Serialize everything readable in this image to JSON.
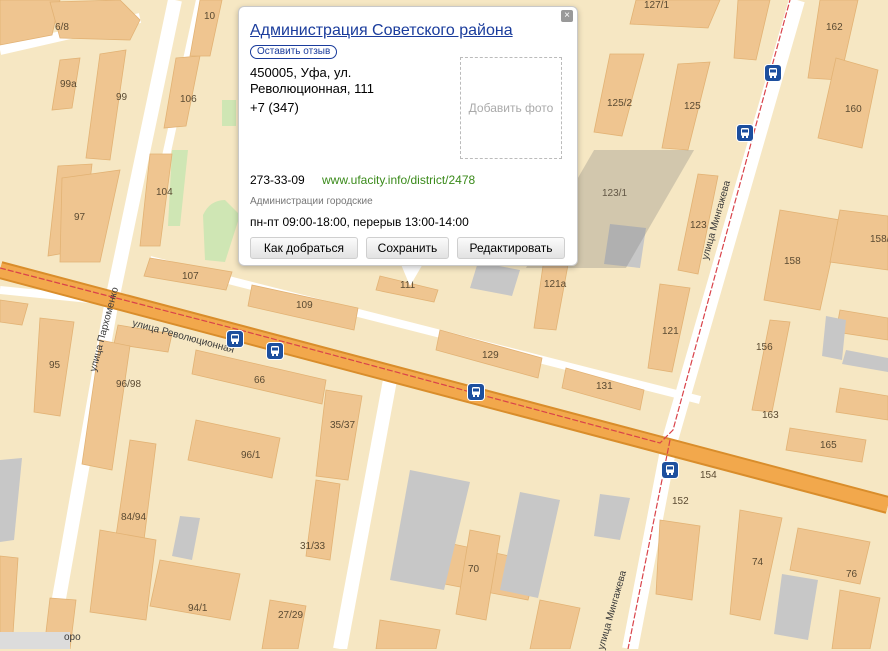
{
  "popup": {
    "title": "Администрация Советского района",
    "review_label": "Оставить отзыв",
    "address": "450005, Уфа, ул. Революционная, 111",
    "phone1": "+7 (347)",
    "add_photo_label": "Добавить фото",
    "phone2": "273-33-09",
    "website": "www.ufacity.info/district/2478",
    "category": "Администрации городские",
    "hours": "пн-пт 09:00-18:00, перерыв 13:00-14:00",
    "buttons": {
      "route": "Как добраться",
      "save": "Сохранить",
      "edit": "Редактировать"
    },
    "close_glyph": "×"
  },
  "streets": {
    "revolutsionnaya": "улица Революционная",
    "mingazheva_top": "улица Мингажева",
    "mingazheva_bottom": "улица Мингажева",
    "parkhomenko": "улица Пархоменко",
    "bottom_left_fragment": "оро"
  },
  "house_numbers": {
    "n6_8": "6/8",
    "n10": "10",
    "n127_1": "127/1",
    "n162": "162",
    "n99a": "99а",
    "n99": "99",
    "n106": "106",
    "n125_2": "125/2",
    "n125": "125",
    "n160": "160",
    "n104": "104",
    "n123_1": "123/1",
    "n97": "97",
    "n123": "123",
    "n158_1": "158/",
    "n158": "158",
    "n107": "107",
    "n111": "111",
    "n121a": "121а",
    "n109": "109",
    "n121": "121",
    "n156": "156",
    "n95": "95",
    "n129": "129",
    "n96_98": "96/98",
    "n66": "66",
    "n131": "131",
    "n163": "163",
    "n35_37": "35/37",
    "n165": "165",
    "n96_1": "96/1",
    "n154": "154",
    "n152": "152",
    "n84_94": "84/94",
    "n31_33": "31/33",
    "n70": "70",
    "n74": "74",
    "n76": "76",
    "n94_1": "94/1",
    "n27_29": "27/29"
  },
  "colors": {
    "background": "#f6e7c3",
    "building": "#efc590",
    "building_dark": "#e6b678",
    "main_road": "#f2a84c",
    "tram_line": "#d9434a",
    "stop_badge": "#1d4f9e",
    "link_blue": "#1a3c9c",
    "url_green": "#3a8a1a"
  },
  "icons": {
    "bus_stop": "bus-stop-icon",
    "close": "close-icon"
  }
}
